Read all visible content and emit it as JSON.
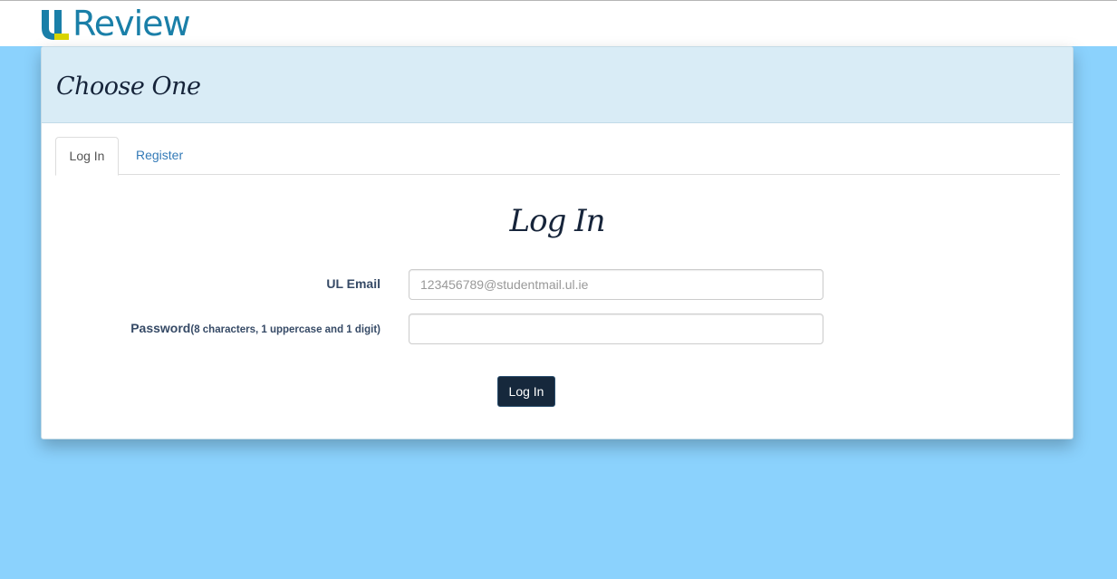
{
  "brand": {
    "logo_text": "Review",
    "colors": {
      "u_blue": "#1a7fa8",
      "u_yellow": "#d9d500"
    }
  },
  "panel": {
    "title": "Choose One"
  },
  "tabs": [
    {
      "label": "Log In",
      "active": true
    },
    {
      "label": "Register",
      "active": false
    }
  ],
  "form": {
    "title": "Log In",
    "email_label": "UL Email",
    "email_placeholder": "123456789@studentmail.ul.ie",
    "email_value": "",
    "password_label": "Password",
    "password_hint": "(8 characters, 1 uppercase and 1 digit)",
    "password_value": "",
    "submit_label": "Log In"
  },
  "colors": {
    "page_background": "#8bd2fd",
    "heading_background": "#d9ecf6",
    "button_background": "#16283c"
  }
}
